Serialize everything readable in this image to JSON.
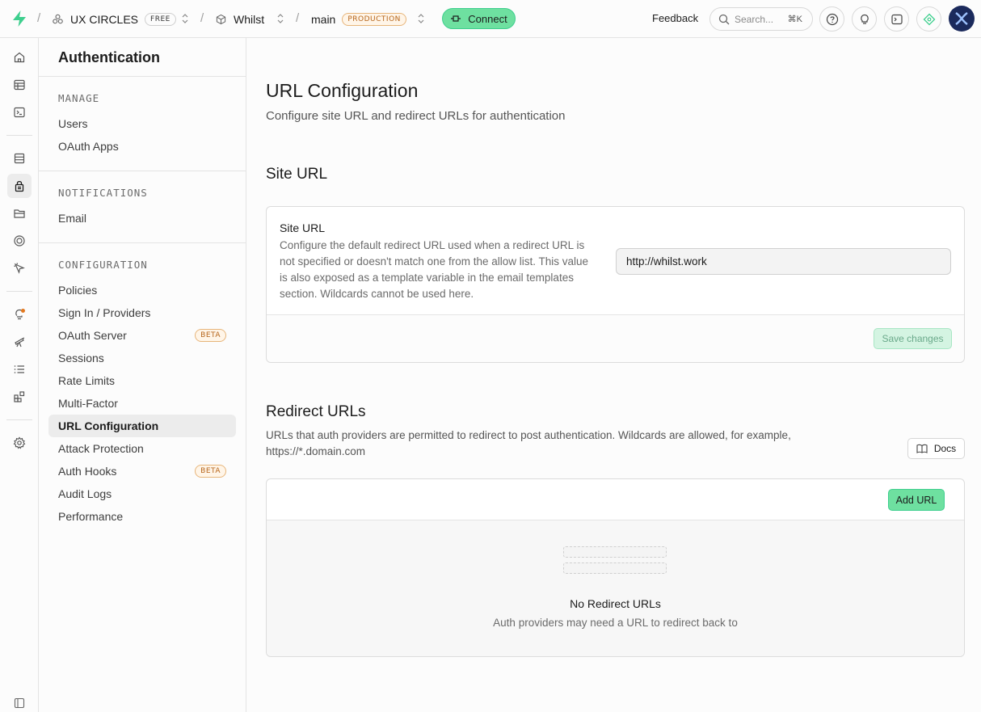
{
  "topbar": {
    "org_name": "UX CIRCLES",
    "org_plan": "FREE",
    "project_name": "Whilst",
    "branch_name": "main",
    "branch_env": "PRODUCTION",
    "connect_label": "Connect",
    "feedback_label": "Feedback",
    "search_placeholder": "Search...",
    "search_shortcut": "⌘K",
    "separator": "/"
  },
  "rail": {
    "icons": [
      "home-icon",
      "table-editor-icon",
      "sql-editor-icon",
      "database-icon",
      "auth-icon",
      "storage-icon",
      "realtime-icon",
      "edge-functions-icon",
      "advisors-icon",
      "reports-icon",
      "logs-icon",
      "integrations-icon",
      "settings-icon",
      "collapse-sidebar-icon"
    ]
  },
  "sidebar": {
    "title": "Authentication",
    "sections": [
      {
        "heading": "MANAGE",
        "items": [
          "Users",
          "OAuth Apps"
        ]
      },
      {
        "heading": "NOTIFICATIONS",
        "items": [
          "Email"
        ]
      },
      {
        "heading": "CONFIGURATION",
        "items": [
          "Policies",
          "Sign In / Providers",
          "OAuth Server",
          "Sessions",
          "Rate Limits",
          "Multi-Factor",
          "URL Configuration",
          "Attack Protection",
          "Auth Hooks",
          "Audit Logs",
          "Performance"
        ]
      }
    ],
    "beta_label": "BETA",
    "active_item": "URL Configuration"
  },
  "main": {
    "title": "URL Configuration",
    "subtitle": "Configure site URL and redirect URLs for authentication",
    "site_url_section": {
      "title": "Site URL",
      "label": "Site URL",
      "description": "Configure the default redirect URL used when a redirect URL is not specified or doesn't match one from the allow list. This value is also exposed as a template variable in the email templates section. Wildcards cannot be used here.",
      "value": "http://whilst.work",
      "save_label": "Save changes"
    },
    "redirect_section": {
      "title": "Redirect URLs",
      "description": "URLs that auth providers are permitted to redirect to post authentication. Wildcards are allowed, for example, https://*.domain.com",
      "docs_label": "Docs",
      "add_label": "Add URL",
      "empty_title": "No Redirect URLs",
      "empty_subtitle": "Auth providers may need a URL to redirect back to"
    }
  },
  "colors": {
    "brand_green": "#3ecf8e",
    "button_green": "#6ee0a0",
    "beta_orange": "#b6651a"
  }
}
